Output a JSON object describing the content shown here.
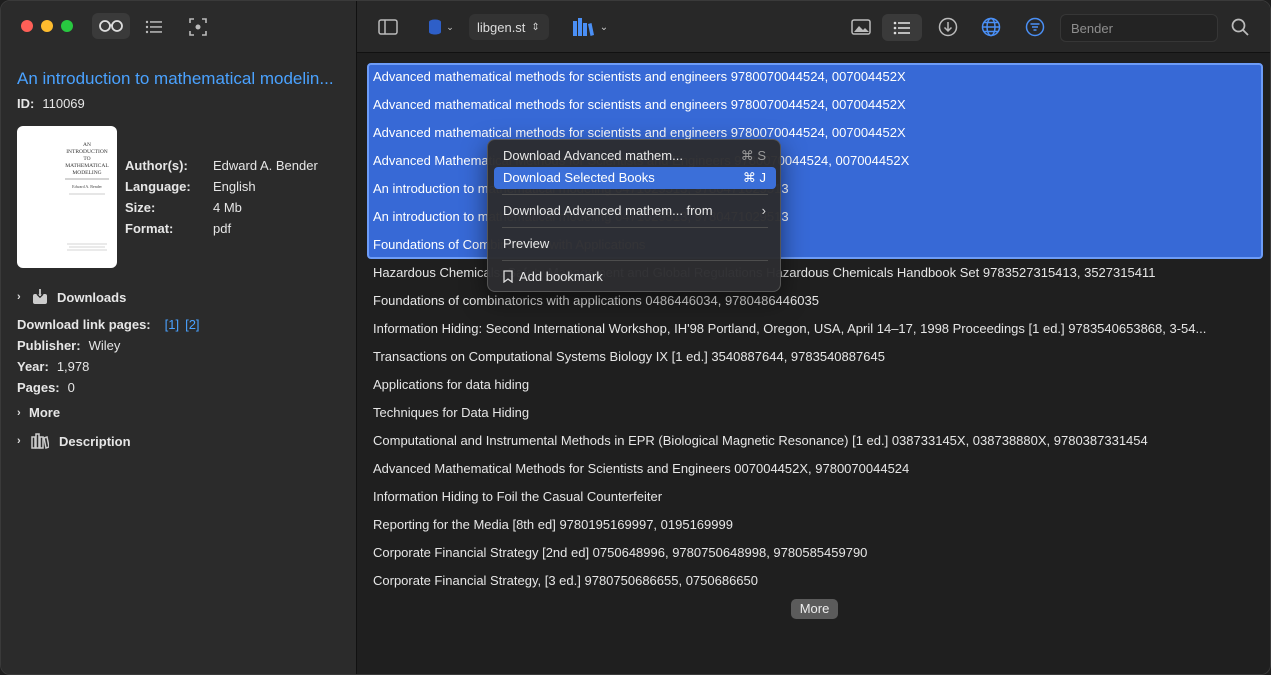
{
  "sidebar": {
    "title": "An introduction to mathematical modelin...",
    "id_label": "ID:",
    "id_value": "110069",
    "cover_lines": [
      "AN",
      "INTRODUCTION",
      "TO",
      "MATHEMATICAL",
      "MODELING",
      "Edward A. Bender"
    ],
    "meta": [
      {
        "label": "Author(s):",
        "value": "Edward A. Bender"
      },
      {
        "label": "Language:",
        "value": "English"
      },
      {
        "label": "Size:",
        "value": "4 Mb"
      },
      {
        "label": "Format:",
        "value": "pdf"
      }
    ],
    "downloads_label": "Downloads",
    "download_pages_label": "Download link pages:",
    "download_pages": [
      "[1]",
      "[2]"
    ],
    "publisher_label": "Publisher:",
    "publisher_value": "Wiley",
    "year_label": "Year:",
    "year_value": "1,978",
    "pages_label": "Pages:",
    "pages_value": "0",
    "more_label": "More",
    "description_label": "Description"
  },
  "toolbar": {
    "source": "libgen.st",
    "search_value": "Bender"
  },
  "books": [
    "Advanced mathematical methods for scientists and engineers 9780070044524, 007004452X",
    "Advanced mathematical methods for scientists and engineers 9780070044524, 007004452X",
    "Advanced mathematical methods for scientists and engineers 9780070044524, 007004452X",
    "Advanced Mathematical Methods for Scientists and Engineers 9780070044524, 007004452X",
    "An introduction to mathematical modeling 0471029513, 9780471029513",
    "An introduction to mathematical modeling 0471029513, 9780471029513",
    "Foundations of Combinatorics with Applications",
    "Hazardous Chemicals: Safety Management and Global Regulations Hazardous Chemicals Handbook Set 9783527315413, 3527315411",
    "Foundations of combinatorics with applications 0486446034, 9780486446035",
    "Information Hiding: Second International Workshop, IH'98 Portland, Oregon, USA, April 14–17, 1998 Proceedings [1 ed.] 9783540653868, 3-54...",
    "Transactions on Computational Systems Biology IX [1 ed.] 3540887644, 9783540887645",
    "Applications for data hiding",
    "Techniques for Data Hiding",
    "Computational and Instrumental Methods in EPR (Biological Magnetic Resonance) [1 ed.] 038733145X, 038738880X, 9780387331454",
    "Advanced Mathematical Methods for Scientists and Engineers 007004452X, 9780070044524",
    "Information Hiding to Foil the Casual Counterfeiter",
    "Reporting for the Media [8th ed] 9780195169997, 0195169999",
    "Corporate Financial Strategy [2nd ed] 0750648996, 9780750648998, 9780585459790",
    "Corporate Financial Strategy, [3 ed.] 9780750686655, 0750686650"
  ],
  "more_button": "More",
  "context_menu": {
    "item1": "Download Advanced mathem...",
    "item1_shortcut": "⌘ S",
    "item2": "Download Selected Books",
    "item2_shortcut": "⌘ J",
    "item3": "Download Advanced mathem... from",
    "item4": "Preview",
    "item5": "Add bookmark"
  }
}
